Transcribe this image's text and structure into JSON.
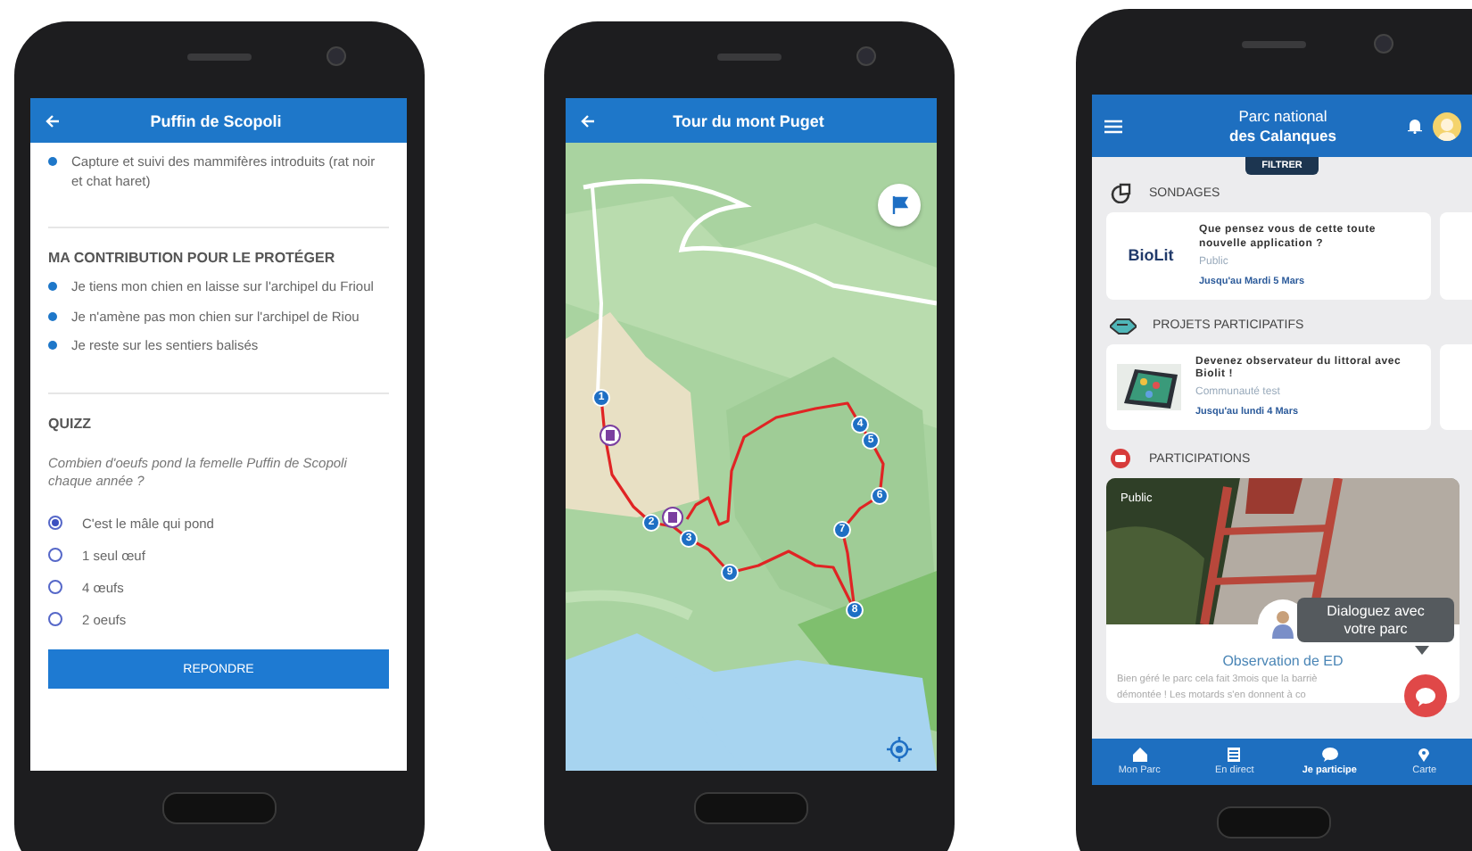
{
  "species_screen": {
    "title": "Puffin de Scopoli",
    "actions": [
      "Capture et suivi des mammifères introduits (rat noir et chat haret)"
    ],
    "contribution": {
      "heading": "MA CONTRIBUTION POUR LE PROTÉGER",
      "items": [
        "Je tiens mon chien en laisse sur l'archipel du Frioul",
        "Je n'amène pas mon chien sur l'archipel de Riou",
        "Je reste sur les sentiers balisés"
      ]
    },
    "quiz": {
      "heading": "QUIZZ",
      "question": "Combien d'oeufs pond la femelle Puffin de Scopoli chaque année ?",
      "options": [
        {
          "label": "C'est le mâle qui pond",
          "selected": true
        },
        {
          "label": "1 seul œuf",
          "selected": false
        },
        {
          "label": "4 œufs",
          "selected": false
        },
        {
          "label": "2 oeufs",
          "selected": false
        }
      ],
      "submit": "REPONDRE"
    }
  },
  "map_screen": {
    "title": "Tour du mont Puget",
    "markers": [
      "1",
      "2",
      "3",
      "4",
      "5",
      "6",
      "7",
      "8",
      "9"
    ]
  },
  "park_screen": {
    "title_line1": "Parc national",
    "title_line2": "des Calanques",
    "filter": "FILTRER",
    "sections": [
      {
        "kind": "survey",
        "heading": "SONDAGES",
        "card": {
          "logo": "BioLit",
          "title": "Que pensez vous de cette toute nouvelle application ?",
          "audience": "Public",
          "deadline": "Jusqu'au Mardi 5 Mars"
        }
      },
      {
        "kind": "project",
        "heading": "PROJETS PARTICIPATIFS",
        "card": {
          "title": "Devenez observateur du littoral avec Biolit !",
          "audience": "Communauté test",
          "deadline": "Jusqu'au lundi 4 Mars"
        }
      },
      {
        "kind": "participation",
        "heading": "PARTICIPATIONS",
        "card": {
          "badge": "Public",
          "title": "Observation de ED",
          "description": [
            "Bien géré le parc cela fait 3mois que la barriè",
            "démontée ! Les motards s'en donnent à co"
          ]
        }
      }
    ],
    "tooltip": "Dialoguez avec votre parc",
    "nav": [
      {
        "label": "Mon Parc",
        "selected": false
      },
      {
        "label": "En direct",
        "selected": false
      },
      {
        "label": "Je participe",
        "selected": true
      },
      {
        "label": "Carte",
        "selected": false
      }
    ]
  }
}
